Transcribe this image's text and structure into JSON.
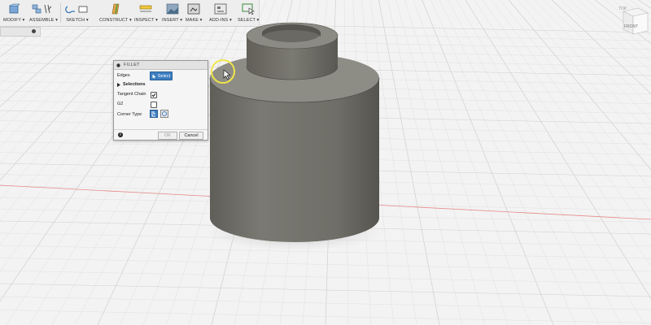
{
  "toolbar": {
    "groups": [
      {
        "label": "MODIFY ▾",
        "icon": "modify-icon"
      },
      {
        "label": "ASSEMBLE ▾",
        "icon": "assemble-icon"
      },
      {
        "label": "SKETCH ▾",
        "icon": "sketch-icon"
      },
      {
        "label": "CONSTRUCT ▾",
        "icon": "construct-icon"
      },
      {
        "label": "INSPECT ▾",
        "icon": "inspect-icon"
      },
      {
        "label": "INSERT ▾",
        "icon": "insert-icon"
      },
      {
        "label": "MAKE ▾",
        "icon": "make-icon"
      },
      {
        "label": "ADD-INS ▾",
        "icon": "add-ins-icon"
      },
      {
        "label": "SELECT ▾",
        "icon": "select-icon"
      }
    ]
  },
  "viewcube": {
    "face": "FRONT",
    "top_label": "TOP"
  },
  "fillet": {
    "title": "FILLET",
    "edges_label": "Edges",
    "select_label": "Select",
    "selections_label": "Selections",
    "tangent_chain_label": "Tangent Chain",
    "tangent_chain_checked": true,
    "g2_label": "G2",
    "g2_checked": false,
    "corner_type_label": "Corner Type",
    "ok_label": "OK",
    "cancel_label": "Cancel"
  },
  "colors": {
    "background": "#f3f3f3",
    "grid_minor": "#e0e0e0",
    "grid_major": "#cfcfcf",
    "red_axis": "#e57b7b",
    "part_body": "#6e6d66",
    "select_button": "#3d7ec0",
    "cursor_highlight": "#f0e64a"
  }
}
